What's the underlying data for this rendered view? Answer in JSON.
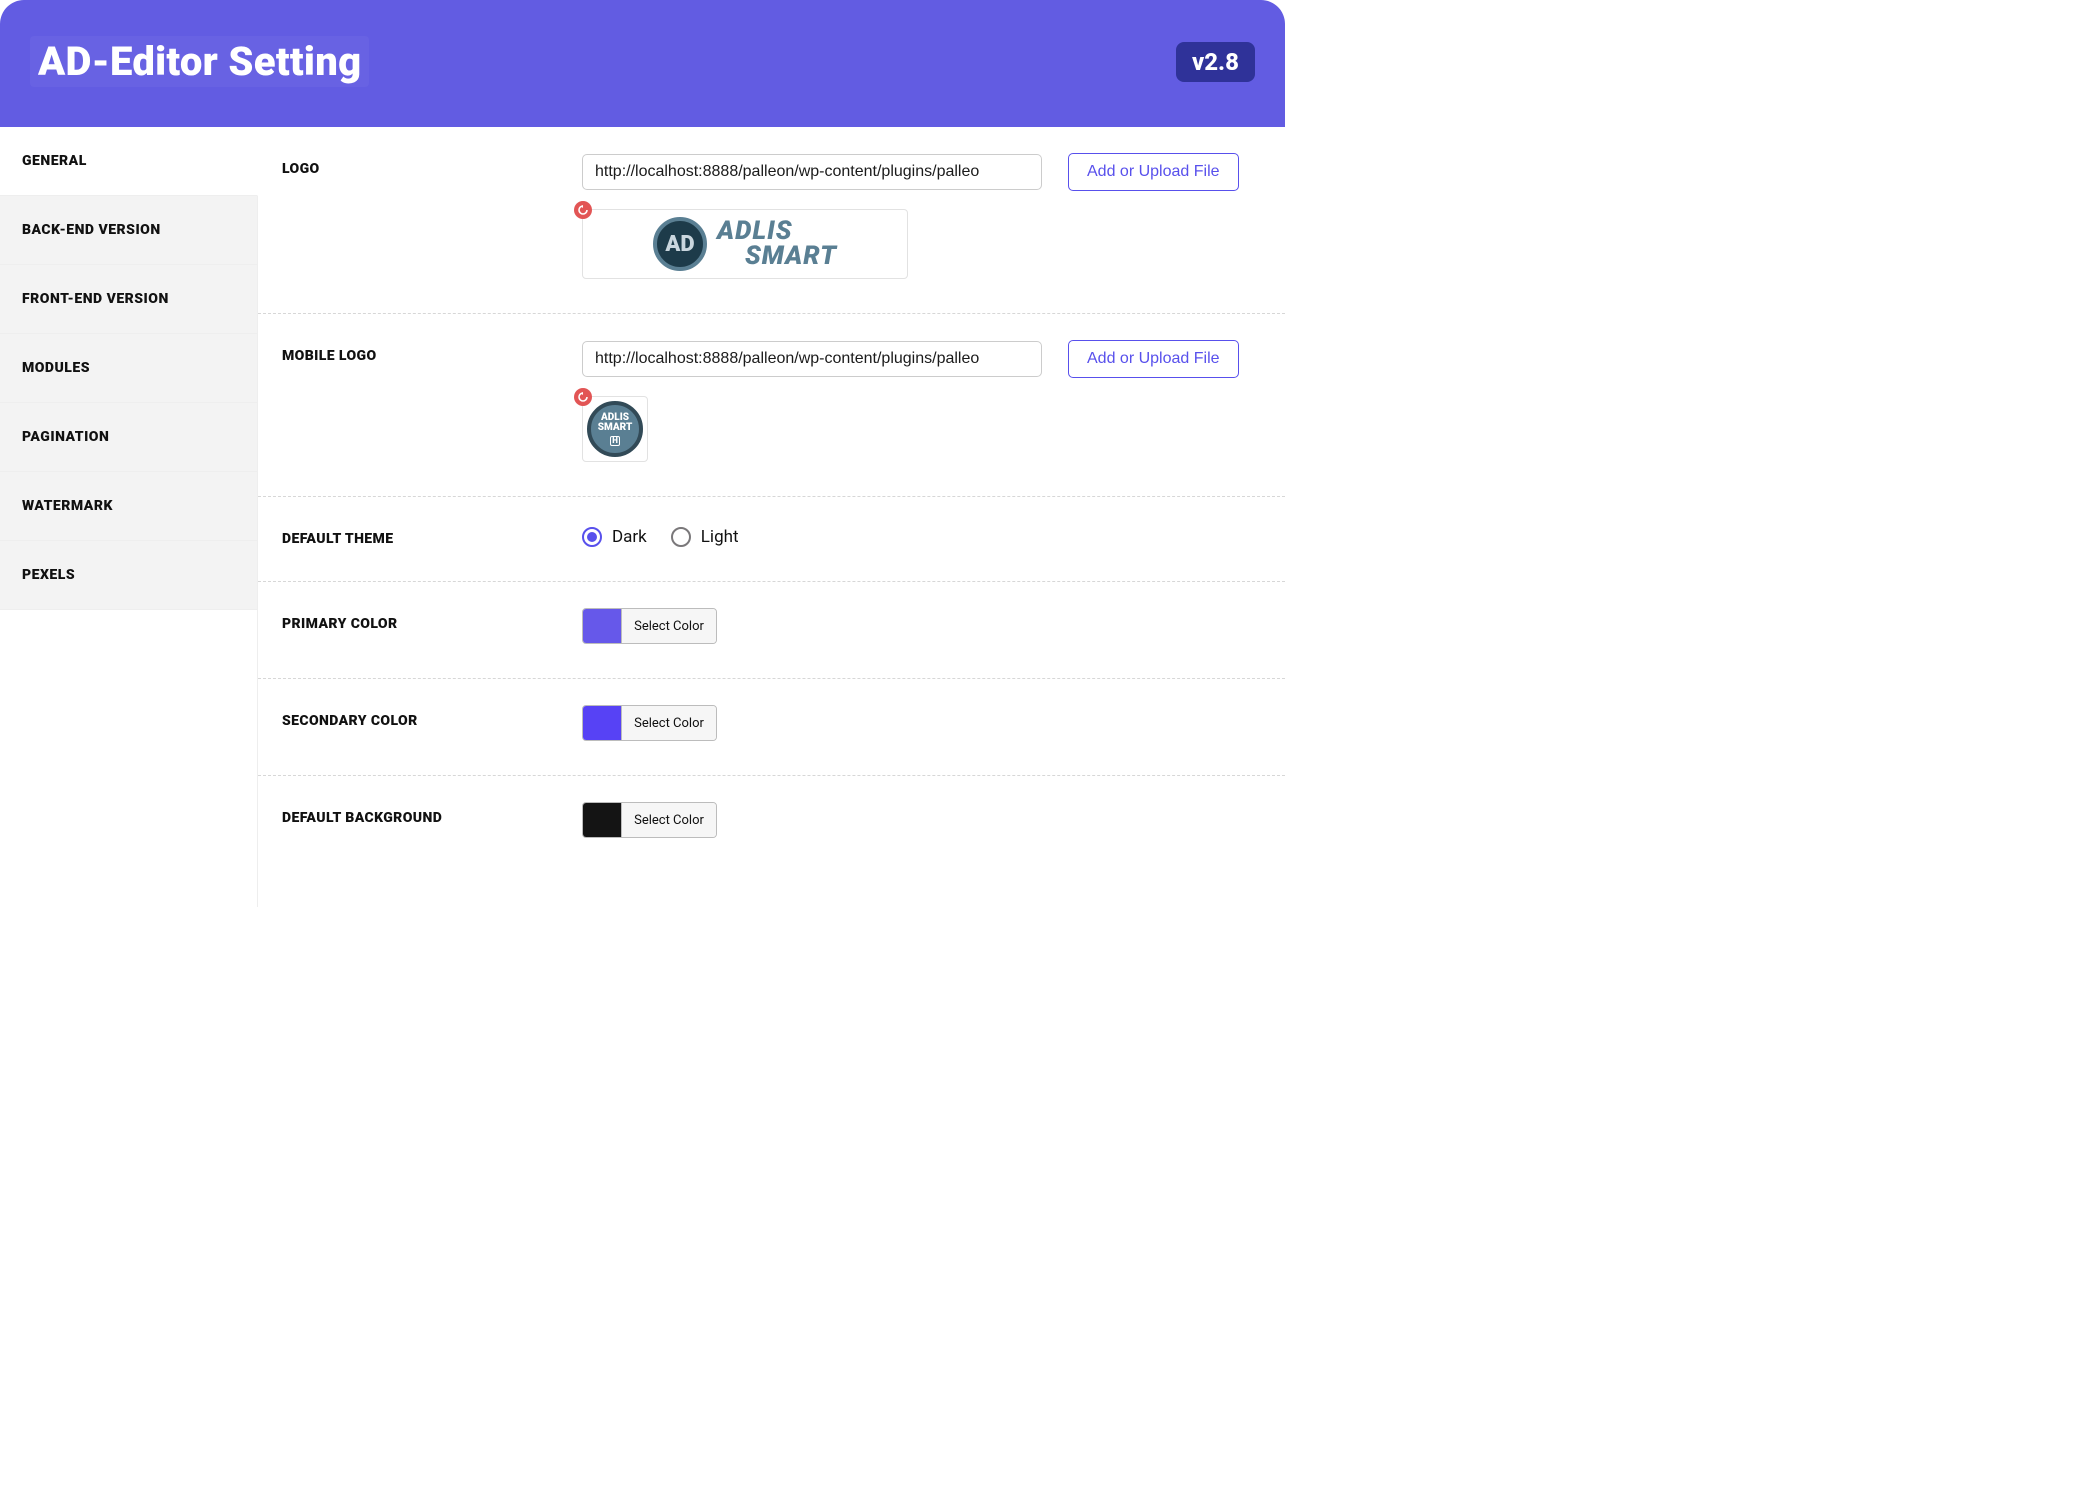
{
  "header": {
    "title": "AD-Editor Setting",
    "version": "v2.8"
  },
  "sidebar": {
    "items": [
      {
        "label": "GENERAL",
        "active": true
      },
      {
        "label": "BACK-END VERSION",
        "active": false
      },
      {
        "label": "FRONT-END VERSION",
        "active": false
      },
      {
        "label": "MODULES",
        "active": false
      },
      {
        "label": "PAGINATION",
        "active": false
      },
      {
        "label": "WATERMARK",
        "active": false
      },
      {
        "label": "PEXELS",
        "active": false
      }
    ]
  },
  "general": {
    "logo": {
      "label": "LOGO",
      "value": "http://localhost:8888/palleon/wp-content/plugins/palleo",
      "upload_label": "Add or Upload File",
      "brand_line1": "ADLIS",
      "brand_line2": "SMART",
      "brand_mark": "AD"
    },
    "mobile_logo": {
      "label": "MOBILE LOGO",
      "value": "http://localhost:8888/palleon/wp-content/plugins/palleo",
      "upload_label": "Add or Upload File",
      "brand_line1": "ADLIS",
      "brand_line2": "SMART"
    },
    "theme": {
      "label": "DEFAULT THEME",
      "selected": "dark",
      "options": {
        "dark": "Dark",
        "light": "Light"
      }
    },
    "primary_color": {
      "label": "PRIMARY COLOR",
      "hex": "#6658EA",
      "select_label": "Select Color"
    },
    "secondary_color": {
      "label": "SECONDARY COLOR",
      "hex": "#5742F5",
      "select_label": "Select Color"
    },
    "default_background": {
      "label": "DEFAULT BACKGROUND",
      "hex": "#141414",
      "select_label": "Select Color"
    }
  }
}
